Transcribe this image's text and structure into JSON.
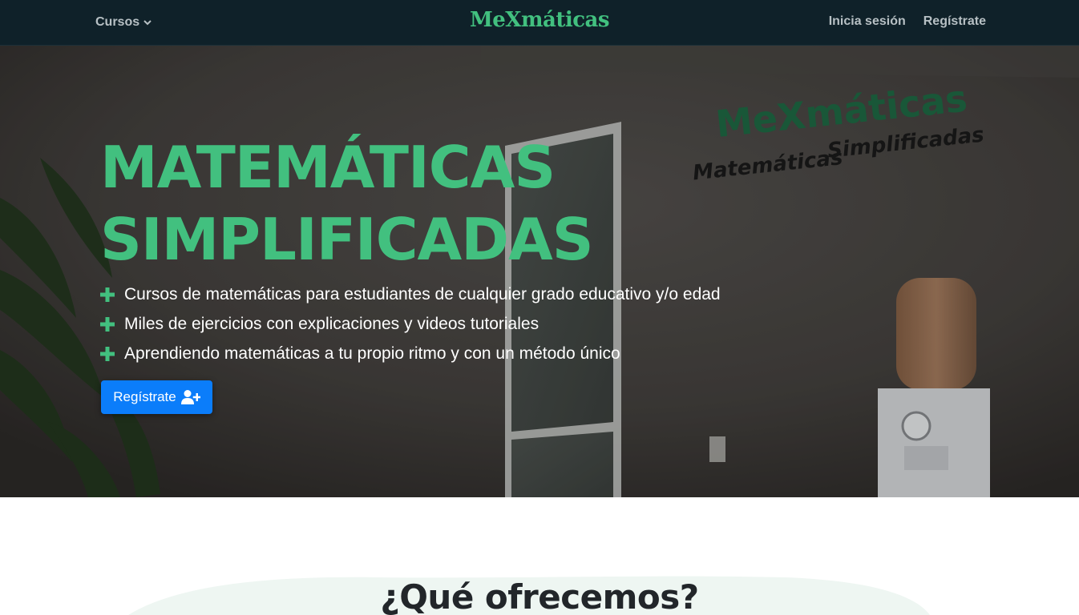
{
  "navbar": {
    "courses_label": "Cursos",
    "brand": "MeXmáticas",
    "login_label": "Inicia sesión",
    "register_label": "Regístrate"
  },
  "hero": {
    "title_line1": "MATEMÁTICAS",
    "title_line2": "SIMPLIFICADAS",
    "features": [
      "Cursos de matemáticas para estudiantes de cualquier grado educativo y/o edad",
      "Miles de ejercicios con explicaciones y videos tutoriales",
      "Aprendiendo matemáticas a tu propio ritmo y con un método único"
    ],
    "cta_label": "Regístrate",
    "wall_sign": {
      "brand": "MeXmáticas",
      "tagline_1": "Matemáticas",
      "tagline_2": "Simplificadas"
    }
  },
  "offer": {
    "title": "¿Qué ofrecemos?"
  },
  "colors": {
    "nav_bg": "#0f2129",
    "brand_green": "#42c07f",
    "primary_button": "#0b7dfa",
    "hero_overlay": "#3d3a38"
  },
  "icons": {
    "courses_dropdown": "chevron-down-icon",
    "feature_bullet": "plus-icon",
    "cta": "user-plus-icon"
  }
}
